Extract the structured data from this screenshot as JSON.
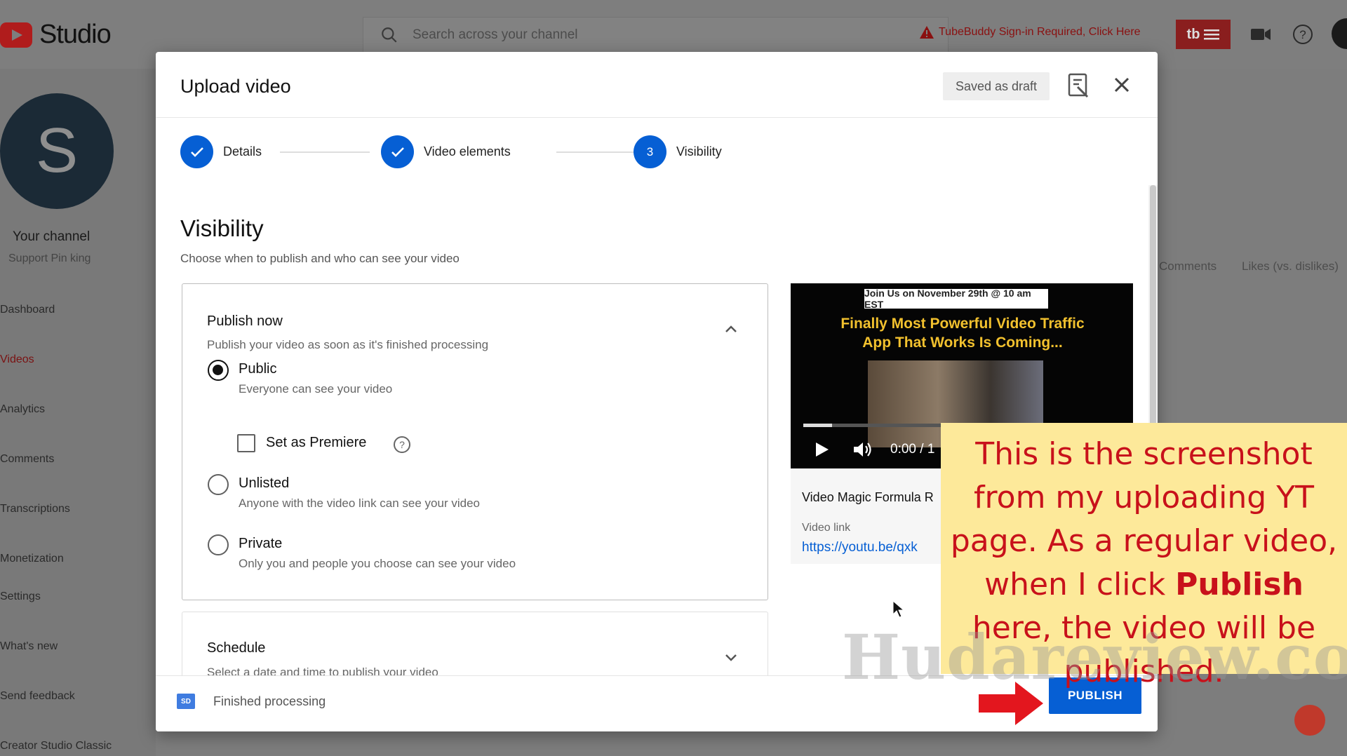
{
  "app": {
    "logo_text": "Studio"
  },
  "topbar": {
    "search_placeholder": "Search across your channel",
    "tubebuddy_warning": "TubeBuddy Sign-in Required, Click Here",
    "tubebuddy_button": "tb"
  },
  "sidebar": {
    "avatar_letter": "S",
    "channel_title": "Your channel",
    "channel_name": "Support Pin king",
    "items": [
      {
        "label": "Dashboard"
      },
      {
        "label": "Videos"
      },
      {
        "label": "Analytics"
      },
      {
        "label": "Comments"
      },
      {
        "label": "Transcriptions"
      },
      {
        "label": "Monetization"
      },
      {
        "label": "Settings"
      },
      {
        "label": "What's new"
      },
      {
        "label": "Send feedback"
      },
      {
        "label": "Creator Studio Classic"
      }
    ]
  },
  "background_table": {
    "col_comments": "Comments",
    "col_likes": "Likes (vs. dislikes)"
  },
  "dialog": {
    "title": "Upload video",
    "draft_status": "Saved as draft",
    "steps": [
      {
        "label": "Details",
        "state": "done"
      },
      {
        "label": "Video elements",
        "state": "done"
      },
      {
        "label": "Visibility",
        "number": "3",
        "state": "current"
      }
    ],
    "visibility": {
      "title": "Visibility",
      "subtitle": "Choose when to publish and who can see your video",
      "publish_now": {
        "title": "Publish now",
        "subtitle": "Publish your video as soon as it's finished processing",
        "options": [
          {
            "label": "Public",
            "desc": "Everyone can see your video",
            "selected": true
          },
          {
            "label": "Unlisted",
            "desc": "Anyone with the video link can see your video",
            "selected": false
          },
          {
            "label": "Private",
            "desc": "Only you and people you choose can see your video",
            "selected": false
          }
        ],
        "premiere_label": "Set as Premiere",
        "premiere_checked": false
      },
      "schedule": {
        "title": "Schedule",
        "subtitle": "Select a date and time to publish your video"
      }
    },
    "preview": {
      "banner": "Join Us on November 29th @ 10 am EST",
      "headline_line1": "Finally Most Powerful Video Traffic",
      "headline_line2": "App That Works Is Coming...",
      "time": "0:00 / 1",
      "progress": 0.09,
      "video_title": "Video Magic Formula R",
      "link_label": "Video link",
      "link_url": "https://youtu.be/qxk"
    },
    "footer": {
      "quality_badge": "SD",
      "status": "Finished processing",
      "publish_label": "PUBLISH"
    }
  },
  "annotation": {
    "part1": "This is the screenshot from my uploading YT page. As a regular video, when I click ",
    "bold": "Publish",
    "part2": " here, the video will be published.",
    "watermark": "Hudareview.com"
  },
  "colors": {
    "brand_blue": "#065fd4",
    "note_bg": "#fde99a",
    "note_text": "#c8111b",
    "arrow": "#e3161e"
  }
}
